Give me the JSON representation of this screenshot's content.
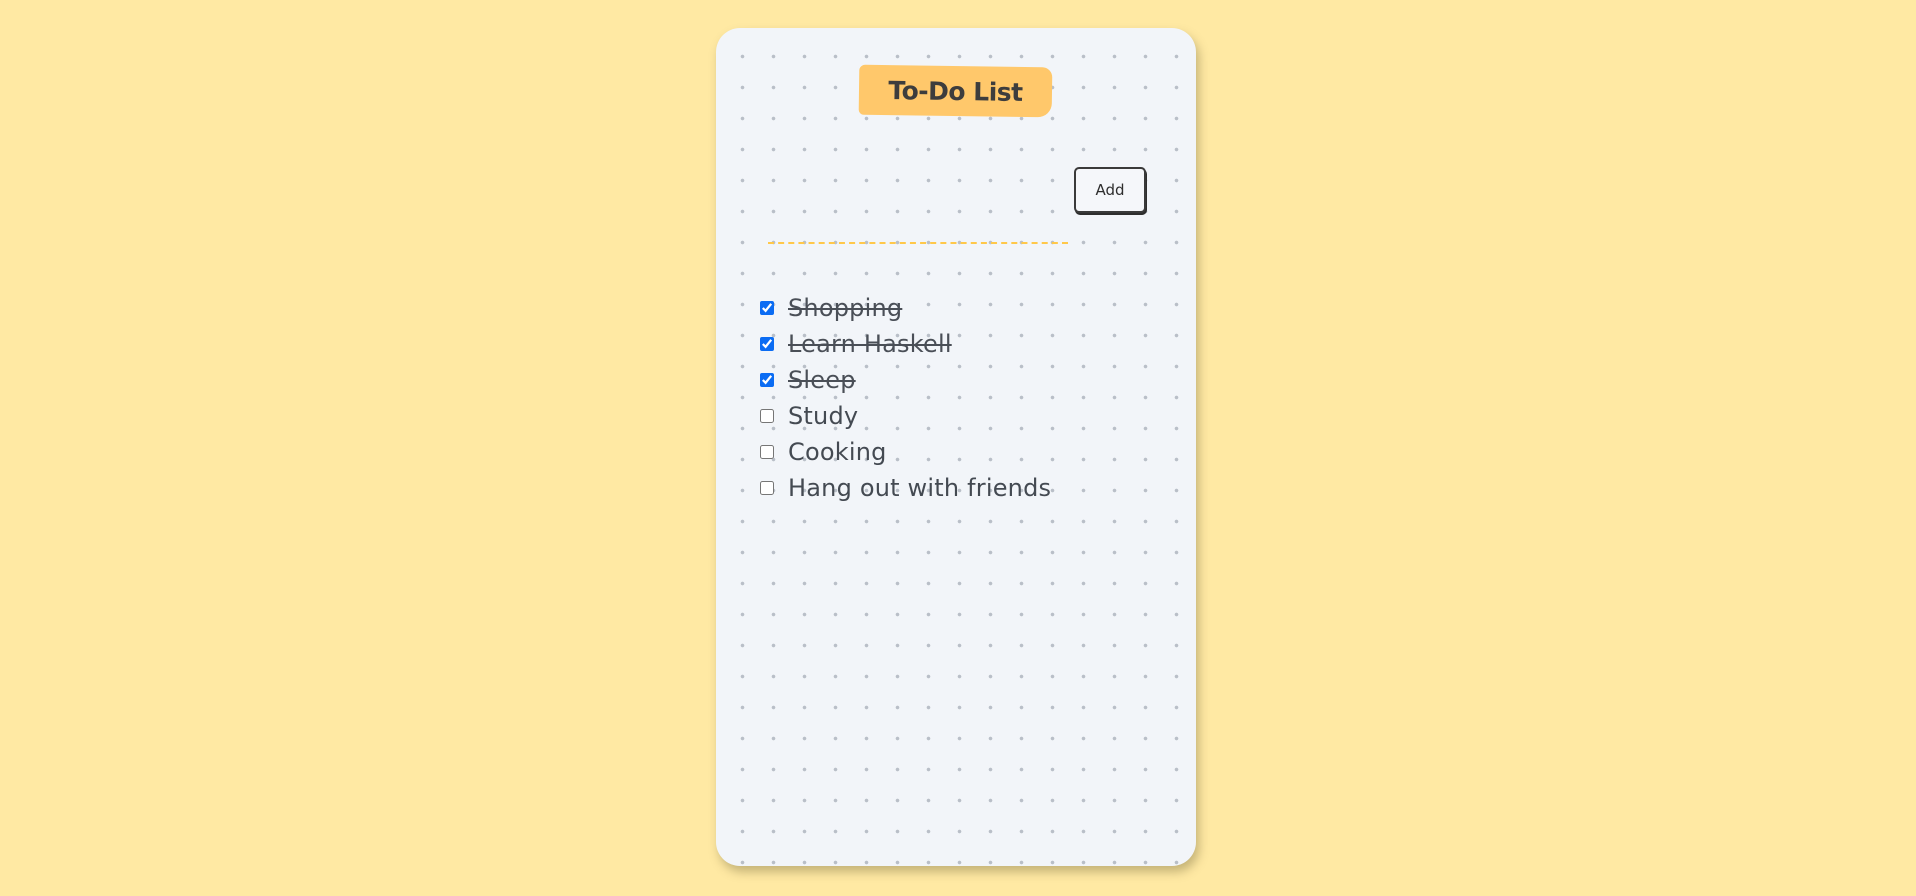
{
  "app": {
    "title": "To-Do List"
  },
  "form": {
    "input_value": "",
    "input_placeholder": "",
    "add_label": "Add"
  },
  "todos": [
    {
      "text": "Shopping",
      "done": true
    },
    {
      "text": "Learn Haskell",
      "done": true
    },
    {
      "text": "Sleep",
      "done": true
    },
    {
      "text": "Study",
      "done": false
    },
    {
      "text": "Cooking",
      "done": false
    },
    {
      "text": "Hang out with friends",
      "done": false
    }
  ],
  "colors": {
    "page_background": "#ffe9a3",
    "card_background": "#f2f5f9",
    "title_tag": "#ffc86b",
    "input_underline": "#ffc84a",
    "checkbox_accent": "#0b6cf3",
    "text": "#444a52"
  }
}
